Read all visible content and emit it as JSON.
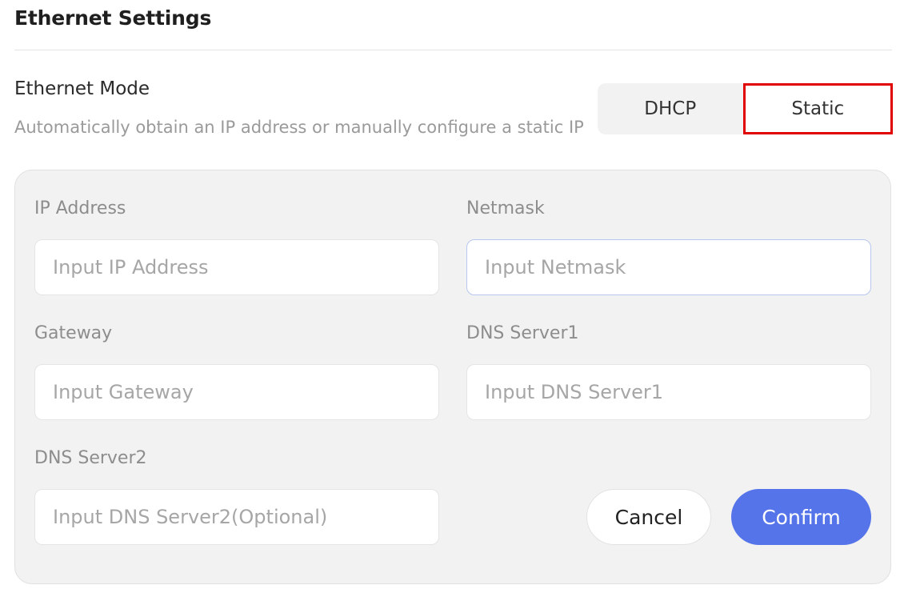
{
  "page": {
    "title": "Ethernet Settings"
  },
  "ethernet_mode": {
    "title": "Ethernet Mode",
    "description": "Automatically obtain an IP address or manually configure a static IP",
    "options": [
      "DHCP",
      "Static"
    ],
    "selected": "Static"
  },
  "form": {
    "ip_address": {
      "label": "IP Address",
      "value": "",
      "placeholder": "Input IP Address"
    },
    "netmask": {
      "label": "Netmask",
      "value": "",
      "placeholder": "Input Netmask"
    },
    "gateway": {
      "label": "Gateway",
      "value": "",
      "placeholder": "Input Gateway"
    },
    "dns1": {
      "label": "DNS Server1",
      "value": "",
      "placeholder": "Input DNS Server1"
    },
    "dns2": {
      "label": "DNS Server2",
      "value": "",
      "placeholder": "Input DNS Server2(Optional)"
    }
  },
  "actions": {
    "cancel_label": "Cancel",
    "confirm_label": "Confirm"
  },
  "colors": {
    "accent": "#5574ea",
    "highlight_border": "#e00000",
    "panel_background": "#f2f2f2",
    "focus_border": "#b9c6ee"
  }
}
